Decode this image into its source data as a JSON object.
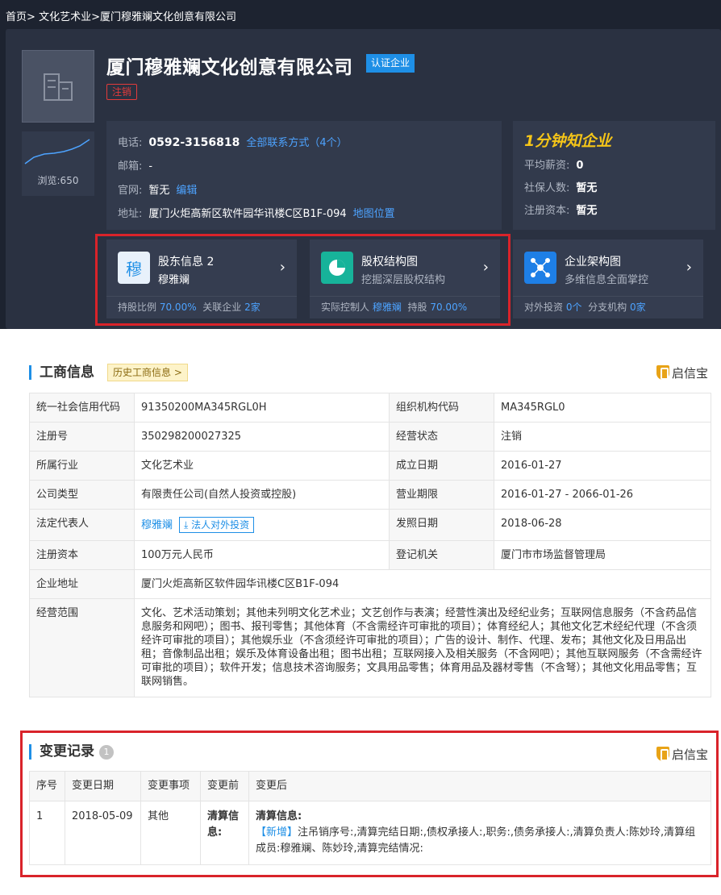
{
  "breadcrumb": {
    "home": "首页",
    "sep": ">",
    "category": "文化艺术业",
    "company": "厦门穆雅斓文化创意有限公司"
  },
  "header": {
    "company_name": "厦门穆雅斓文化创意有限公司",
    "cert_badge": "认证企业",
    "status_badge": "注销",
    "views": "浏览:650"
  },
  "contact": {
    "phone_label": "电话:",
    "phone": "0592-3156818",
    "all_contacts": "全部联系方式（4个）",
    "email_label": "邮箱:",
    "email": "-",
    "site_label": "官网:",
    "site": "暂无",
    "edit": "编辑",
    "addr_label": "地址:",
    "addr": "厦门火炬高新区软件园华讯楼C区B1F-094",
    "map": "地图位置"
  },
  "quick": {
    "title": "1分钟知企业",
    "salary_label": "平均薪资:",
    "salary": "0",
    "insured_label": "社保人数:",
    "insured": "暂无",
    "capital_label": "注册资本:",
    "capital": "暂无"
  },
  "cards": [
    {
      "icon_text": "穆",
      "title": "股东信息 2",
      "subtitle": "穆雅斓",
      "foot1_label": "持股比例",
      "foot1_value": "70.00%",
      "foot2_label": "关联企业",
      "foot2_value": "2家"
    },
    {
      "title": "股权结构图",
      "subtitle": "挖掘深层股权结构",
      "foot1_label": "实际控制人",
      "foot1_value": "穆雅斓",
      "foot2_label": "持股",
      "foot2_value": "70.00%"
    },
    {
      "title": "企业架构图",
      "subtitle": "多维信息全面掌控",
      "foot1_label": "对外投资",
      "foot1_value": "0个",
      "foot2_label": "分支机构",
      "foot2_value": "0家"
    }
  ],
  "business": {
    "title": "工商信息",
    "history_btn": "历史工商信息 >",
    "brand": "启信宝",
    "rows": [
      {
        "k1": "统一社会信用代码",
        "v1": "91350200MA345RGL0H",
        "k2": "组织机构代码",
        "v2": "MA345RGL0"
      },
      {
        "k1": "注册号",
        "v1": "350298200027325",
        "k2": "经营状态",
        "v2": "注销"
      },
      {
        "k1": "所属行业",
        "v1": "文化艺术业",
        "k2": "成立日期",
        "v2": "2016-01-27"
      },
      {
        "k1": "公司类型",
        "v1": "有限责任公司(自然人投资或控股)",
        "k2": "营业期限",
        "v2": "2016-01-27 - 2066-01-26"
      },
      {
        "k1": "法定代表人",
        "v1": "穆雅斓",
        "v1_btn": "法人对外投资",
        "k2": "发照日期",
        "v2": "2018-06-28"
      },
      {
        "k1": "注册资本",
        "v1": "100万元人民币",
        "k2": "登记机关",
        "v2": "厦门市市场监督管理局"
      }
    ],
    "address_label": "企业地址",
    "address": "厦门火炬高新区软件园华讯楼C区B1F-094",
    "scope_label": "经营范围",
    "scope": "文化、艺术活动策划；其他未列明文化艺术业；文艺创作与表演；经营性演出及经纪业务；互联网信息服务（不含药品信息服务和网吧）；图书、报刊零售；其他体育（不含需经许可审批的项目）；体育经纪人；其他文化艺术经纪代理（不含须经许可审批的项目）；其他娱乐业（不含须经许可审批的项目）；广告的设计、制作、代理、发布；其他文化及日用品出租；音像制品出租；娱乐及体育设备出租；图书出租；互联网接入及相关服务（不含网吧）；其他互联网服务（不含需经许可审批的项目）；软件开发；信息技术咨询服务；文具用品零售；体育用品及器材零售（不含弩）；其他文化用品零售；互联网销售。"
  },
  "changes": {
    "title": "变更记录",
    "count": "1",
    "brand": "启信宝",
    "headers": [
      "序号",
      "变更日期",
      "变更事项",
      "变更前",
      "变更后"
    ],
    "rows": [
      {
        "no": "1",
        "date": "2018-05-09",
        "item": "其他",
        "before": "清算信息:",
        "after_title": "清算信息:",
        "after_tag": "【新增】",
        "after_text": "注吊销序号:,清算完结日期:,债权承接人:,职务:,债务承接人:,清算负责人:陈妙玲,清算组成员:穆雅斓、陈妙玲,清算完结情况:"
      }
    ]
  },
  "colors": {
    "accent": "#1e8fe6",
    "dark_bg": "#1d2330",
    "highlight_red": "#d9232a",
    "gold": "#f5c518"
  }
}
